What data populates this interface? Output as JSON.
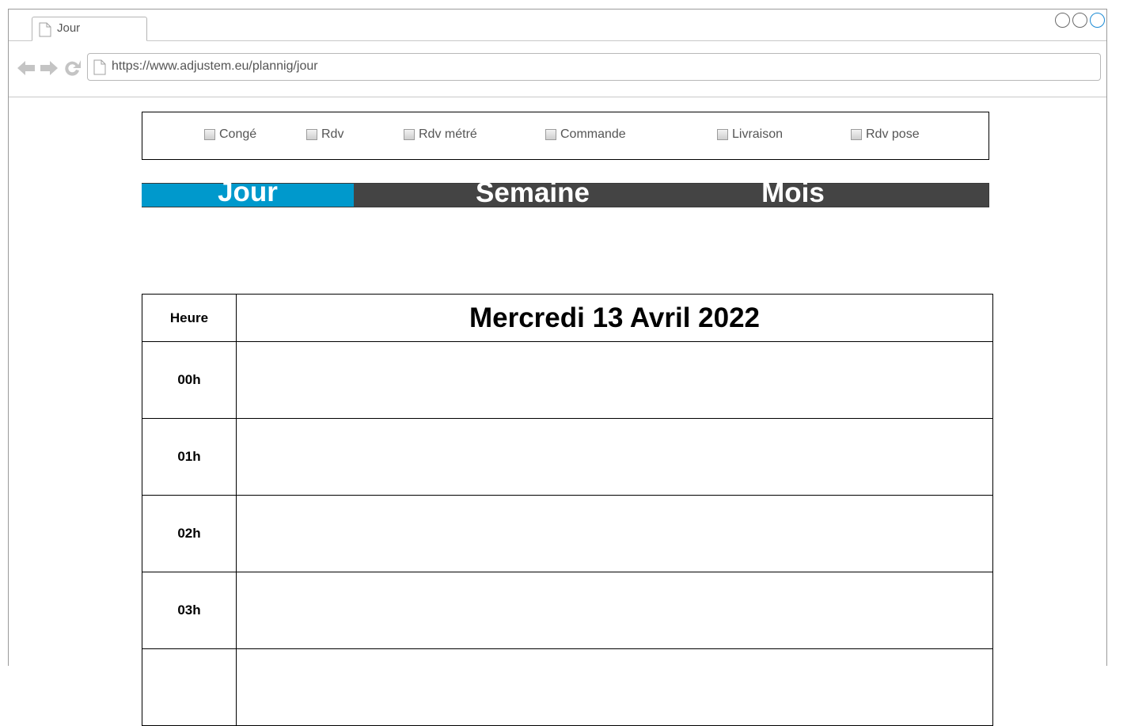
{
  "browser": {
    "tab_title": "Jour",
    "url": "https://www.adjustem.eu/plannig/jour",
    "icons": [
      "back-arrow-icon",
      "forward-arrow-icon",
      "reload-icon",
      "page-icon"
    ]
  },
  "filters": [
    {
      "label": "Congé",
      "checked": false
    },
    {
      "label": "Rdv",
      "checked": false
    },
    {
      "label": "Rdv métré",
      "checked": false
    },
    {
      "label": "Commande",
      "checked": false
    },
    {
      "label": "Livraison",
      "checked": false
    },
    {
      "label": "Rdv pose",
      "checked": false
    }
  ],
  "views": {
    "items": [
      "Jour",
      "Semaine",
      "Mois"
    ],
    "active": "Jour",
    "active_color": "#0099cc",
    "bar_color": "#444444"
  },
  "calendar": {
    "hour_header": "Heure",
    "day_title": "Mercredi 13 Avril 2022",
    "hours": [
      "00h",
      "01h",
      "02h",
      "03h",
      ""
    ]
  }
}
